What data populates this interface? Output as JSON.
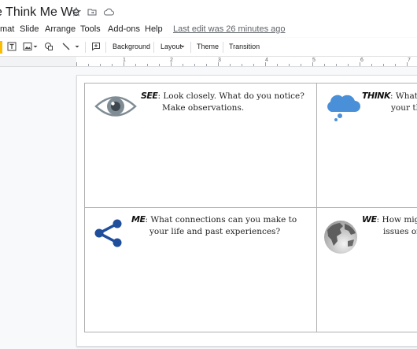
{
  "document": {
    "title": "e Think Me We"
  },
  "menubar": {
    "items": [
      "mat",
      "Slide",
      "Arrange",
      "Tools",
      "Add-ons",
      "Help"
    ],
    "last_edit": "Last edit was 26 minutes ago"
  },
  "toolbar": {
    "background_label": "Background",
    "layout_label": "Layout",
    "theme_label": "Theme",
    "transition_label": "Transition"
  },
  "ruler": {
    "numbers": [
      "1",
      "2",
      "3",
      "4",
      "5",
      "6",
      "7"
    ]
  },
  "slide": {
    "quadrants": [
      {
        "keyword": "SEE",
        "line1": ": Look closely. What do you notice?",
        "line2": "Make observations.",
        "icon": "eye-icon"
      },
      {
        "keyword": "THINK",
        "line1": ": What th",
        "line2": "your th",
        "icon": "thought-cloud-icon"
      },
      {
        "keyword": "ME",
        "line1": ": What connections can you make to",
        "line2": "your life and past experiences?",
        "icon": "share-icon"
      },
      {
        "keyword": "WE",
        "line1": ": How mig",
        "line2": "issues or",
        "icon": "globe-icon"
      }
    ]
  },
  "colors": {
    "accent_blue": "#1f4e9c",
    "cloud_blue": "#4a90d9",
    "eye_gray": "#7f8c94"
  }
}
